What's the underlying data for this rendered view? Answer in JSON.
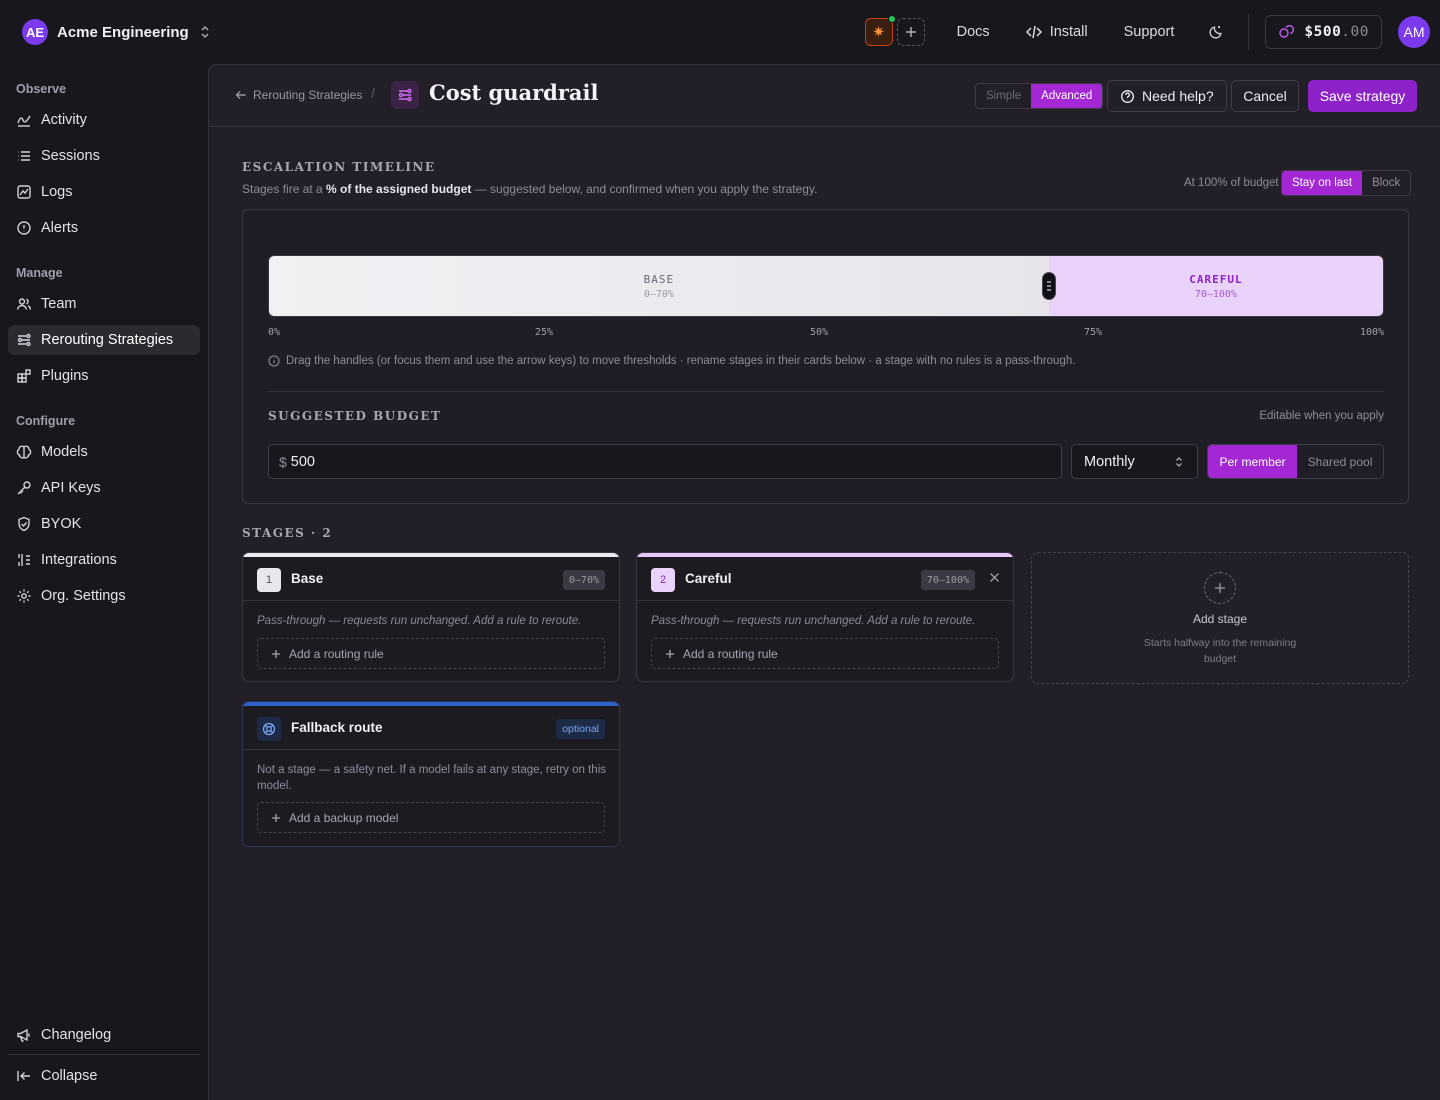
{
  "org": {
    "initials": "AE",
    "name": "Acme Engineering"
  },
  "topbar": {
    "links": {
      "docs": "Docs",
      "install": "Install",
      "support": "Support"
    },
    "credits": {
      "amount": "$500",
      "cents": ".00"
    },
    "user_initials": "AM"
  },
  "sidebar": {
    "sections": {
      "observe": "Observe",
      "manage": "Manage",
      "configure": "Configure"
    },
    "items": {
      "activity": "Activity",
      "sessions": "Sessions",
      "logs": "Logs",
      "alerts": "Alerts",
      "team": "Team",
      "rerouting": "Rerouting Strategies",
      "plugins": "Plugins",
      "models": "Models",
      "api_keys": "API Keys",
      "byok": "BYOK",
      "integrations": "Integrations",
      "org_settings": "Org. Settings",
      "changelog": "Changelog",
      "collapse": "Collapse"
    },
    "active": "rerouting"
  },
  "header": {
    "breadcrumb": "Rerouting Strategies",
    "separator": "/",
    "title": "Cost guardrail",
    "mode": {
      "simple": "Simple",
      "advanced": "Advanced",
      "selected": "advanced"
    },
    "help": "Need help?",
    "cancel": "Cancel",
    "save": "Save strategy"
  },
  "timeline": {
    "title": "ESCALATION TIMELINE",
    "subtitle_pre": "Stages fire at a ",
    "subtitle_bold": "% of the assigned budget",
    "subtitle_post": " — suggested below, and confirmed when you apply the strategy.",
    "at_label": "At 100% of budget",
    "at_options": {
      "stay": "Stay on last",
      "block": "Block",
      "selected": "stay"
    },
    "threshold_fraction": 0.7,
    "segments": [
      {
        "name": "BASE",
        "range": "0–70%"
      },
      {
        "name": "CAREFUL",
        "range": "70–100%"
      }
    ],
    "ticks": [
      "0%",
      "25%",
      "50%",
      "75%",
      "100%"
    ],
    "hint": "Drag the handles (or focus them and use the arrow keys) to move thresholds · rename stages in their cards below · a stage with no rules is a pass-through."
  },
  "budget": {
    "title": "SUGGESTED BUDGET",
    "note": "Editable when you apply",
    "currency": "$",
    "value": "500",
    "period": "Monthly",
    "scope": {
      "per_member": "Per member",
      "shared": "Shared pool",
      "selected": "per_member"
    }
  },
  "stages": {
    "title": "STAGES · 2",
    "items": [
      {
        "num": "1",
        "name": "Base",
        "range": "0–70%",
        "note": "Pass-through — requests run unchanged. Add a rule to reroute.",
        "add_rule": "Add a routing rule"
      },
      {
        "num": "2",
        "name": "Careful",
        "range": "70–100%",
        "note": "Pass-through — requests run unchanged. Add a rule to reroute.",
        "add_rule": "Add a routing rule"
      }
    ],
    "add_stage": {
      "label": "Add stage",
      "sub": "Starts halfway into the remaining budget"
    },
    "fallback": {
      "name": "Fallback route",
      "badge": "optional",
      "note": "Not a stage — a safety net. If a model fails at any stage, retry on this model.",
      "add": "Add a backup model"
    }
  },
  "colors": {
    "accent": "#a327d3",
    "save": "#8d22c9",
    "base_segment": "#f1f0f3",
    "careful_segment": "#ead3fb",
    "fallback_line": "#2f63c9"
  }
}
